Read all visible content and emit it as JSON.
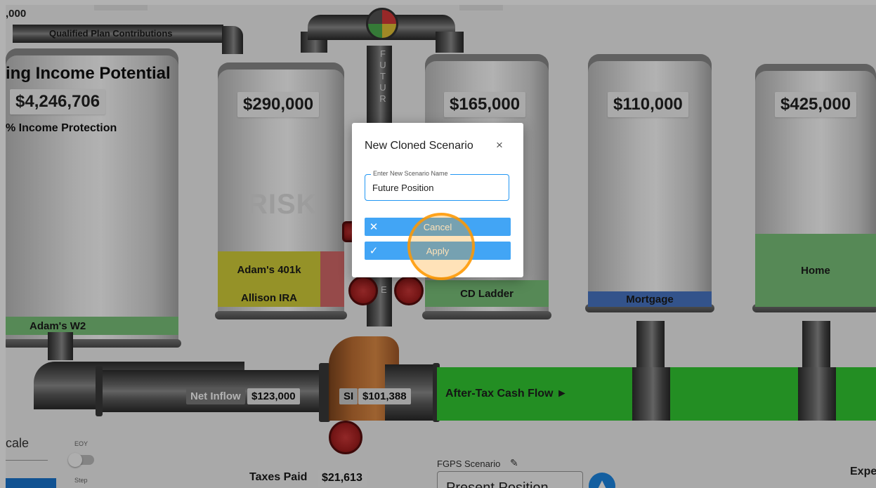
{
  "top": {
    "partial_value": ",000",
    "qualified_label": "Qualified Plan Contributions"
  },
  "income_tank": {
    "title": "ing Income Potential",
    "value": "$4,246,706",
    "protection": "% Income Protection",
    "band": "Adam's W2"
  },
  "tanks": [
    {
      "value": "$290,000",
      "watermark": "RISK",
      "bands": [
        "Adam's 401k",
        "Allison IRA"
      ]
    },
    {
      "value": "$165,000",
      "bands": [
        "CD Ladder"
      ]
    },
    {
      "value": "$110,000",
      "bands": [
        "Mortgage"
      ]
    },
    {
      "value": "$425,000",
      "bands": [
        "Home"
      ]
    }
  ],
  "vertical_letters": "FUTUR",
  "vertical_letter_lower": "E",
  "flow": {
    "net_inflow_label": "Net Inflow",
    "net_inflow_value": "$123,000",
    "si_label": "SI",
    "si_value": "$101,388",
    "after_tax": "After-Tax Cash Flow ►"
  },
  "bottom": {
    "scale_label": "cale",
    "eoy_label": "EOY",
    "step_label": "Step",
    "taxes_label": "Taxes Paid",
    "taxes_value": "$21,613",
    "scenario_label": "FGPS Scenario",
    "scenario_value": "Present Position",
    "expe_label": "Expe"
  },
  "modal": {
    "title": "New Cloned Scenario",
    "close": "×",
    "field_label": "Enter New Scenario Name",
    "field_value": "Future Position",
    "cancel_icon": "✕",
    "cancel_label": "Cancel",
    "apply_icon": "✓",
    "apply_label": "Apply"
  },
  "colors": {
    "accent": "#42a5f5",
    "green_band": "#7cc47c",
    "yellow_band": "#d6d23a",
    "red_band": "#d76a6a",
    "blue_band": "#4a78c8",
    "cash_flow": "#33cc33",
    "highlight": "#ff9800"
  }
}
